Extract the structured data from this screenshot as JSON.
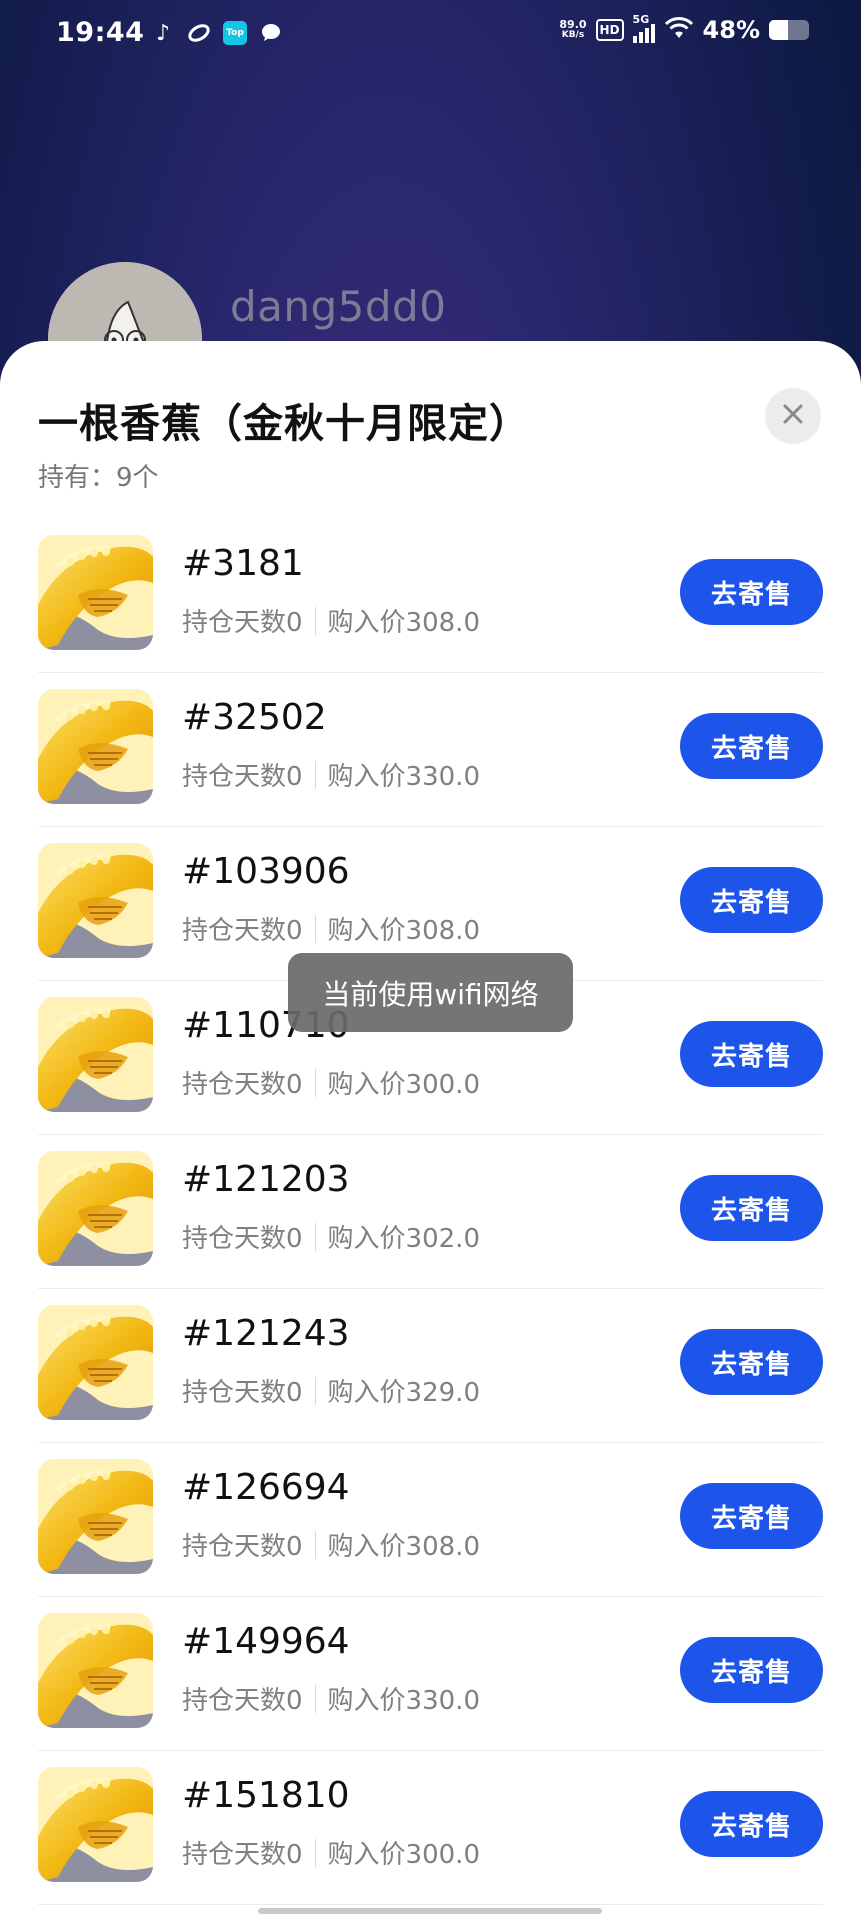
{
  "status_bar": {
    "time": "19:44",
    "net_speed_value": "89.0",
    "net_speed_unit": "KB/s",
    "hd_label": "HD",
    "signal_label": "5G",
    "battery_percent": "48%",
    "battery_level": 0.48,
    "left_icons": [
      "tiktok-icon",
      "sync-icon",
      "top-app-icon",
      "chat-bubble-icon"
    ],
    "top_app_label": "Top"
  },
  "profile": {
    "username": "dang5dd0"
  },
  "sheet": {
    "title": "一根香蕉（金秋十月限定）",
    "holding": "持有：9个",
    "close_icon": "close-icon"
  },
  "items": [
    {
      "id": "#3181",
      "days": "持仓天数0",
      "price": "购入价308.0",
      "button": "去寄售"
    },
    {
      "id": "#32502",
      "days": "持仓天数0",
      "price": "购入价330.0",
      "button": "去寄售"
    },
    {
      "id": "#103906",
      "days": "持仓天数0",
      "price": "购入价308.0",
      "button": "去寄售"
    },
    {
      "id": "#110710",
      "days": "持仓天数0",
      "price": "购入价300.0",
      "button": "去寄售"
    },
    {
      "id": "#121203",
      "days": "持仓天数0",
      "price": "购入价302.0",
      "button": "去寄售"
    },
    {
      "id": "#121243",
      "days": "持仓天数0",
      "price": "购入价329.0",
      "button": "去寄售"
    },
    {
      "id": "#126694",
      "days": "持仓天数0",
      "price": "购入价308.0",
      "button": "去寄售"
    },
    {
      "id": "#149964",
      "days": "持仓天数0",
      "price": "购入价330.0",
      "button": "去寄售"
    },
    {
      "id": "#151810",
      "days": "持仓天数0",
      "price": "购入价300.0",
      "button": "去寄售"
    }
  ],
  "toast": "当前使用wifi网络",
  "colors": {
    "accent": "#1d55ea",
    "thumb_yellow": "#f5c417"
  }
}
